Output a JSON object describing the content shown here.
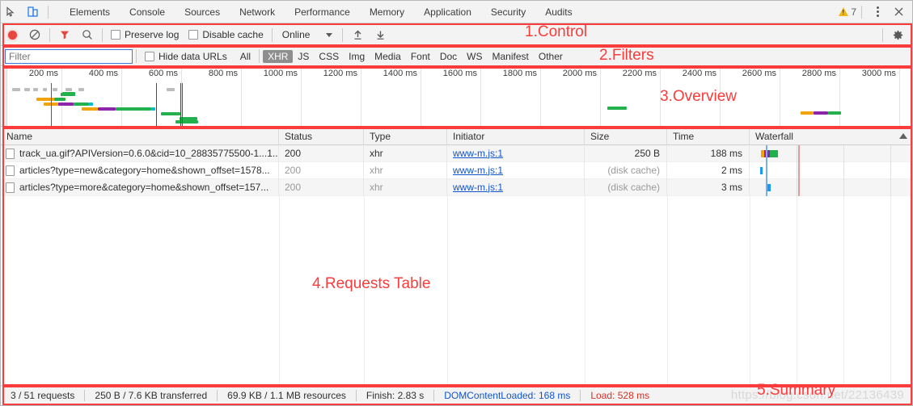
{
  "window": {
    "tabs": [
      "Elements",
      "Console",
      "Sources",
      "Network",
      "Performance",
      "Memory",
      "Application",
      "Security",
      "Audits"
    ],
    "warning_count": "7",
    "inspect_icon": "inspect-element-icon",
    "device_icon": "device-toolbar-icon",
    "more_icon": "more-options-icon",
    "close_icon": "close-icon"
  },
  "control": {
    "record_icon": "record-button",
    "clear_icon": "clear-button",
    "filter_icon": "filter-toggle-icon",
    "search_icon": "search-icon",
    "preserve_log": "Preserve log",
    "disable_cache": "Disable cache",
    "throttle_value": "Online",
    "import_icon": "import-har-icon",
    "export_icon": "export-har-icon",
    "settings_icon": "gear-icon"
  },
  "filters": {
    "placeholder": "Filter",
    "value": "",
    "hide_data_urls": "Hide data URLs",
    "types": [
      "All",
      "XHR",
      "JS",
      "CSS",
      "Img",
      "Media",
      "Font",
      "Doc",
      "WS",
      "Manifest",
      "Other"
    ],
    "active_type": "XHR"
  },
  "overview": {
    "ticks": [
      "200 ms",
      "400 ms",
      "600 ms",
      "800 ms",
      "1000 ms",
      "1200 ms",
      "1400 ms",
      "1600 ms",
      "1800 ms",
      "2000 ms",
      "2200 ms",
      "2400 ms",
      "2600 ms",
      "2800 ms",
      "3000 ms"
    ],
    "dcl_color": "#1565d8",
    "load_color": "#b02020"
  },
  "table": {
    "columns": [
      "Name",
      "Status",
      "Type",
      "Initiator",
      "Size",
      "Time",
      "Waterfall"
    ],
    "sort_column": "Waterfall",
    "rows": [
      {
        "name": "track_ua.gif?APIVersion=0.6.0&cid=10_28835775500-1...1...",
        "status": "200",
        "type": "xhr",
        "initiator": "www-m.js:1",
        "size": "250 B",
        "size_muted": false,
        "time": "188 ms"
      },
      {
        "name": "articles?type=new&category=home&shown_offset=1578...",
        "status": "200",
        "type": "xhr",
        "initiator": "www-m.js:1",
        "size": "(disk cache)",
        "size_muted": true,
        "time": "2 ms"
      },
      {
        "name": "articles?type=more&category=home&shown_offset=157...",
        "status": "200",
        "type": "xhr",
        "initiator": "www-m.js:1",
        "size": "(disk cache)",
        "size_muted": true,
        "time": "3 ms"
      }
    ]
  },
  "summary": {
    "requests": "3 / 51 requests",
    "transferred": "250 B / 7.6 KB transferred",
    "resources": "69.9 KB / 1.1 MB resources",
    "finish": "Finish: 2.83 s",
    "dom_content_loaded": "DOMContentLoaded: 168 ms",
    "load": "Load: 528 ms",
    "watermark": "https://blog.csdn.net/22136439"
  },
  "annotations": [
    {
      "label": "1.Control"
    },
    {
      "label": "2.Filters"
    },
    {
      "label": "3.Overview"
    },
    {
      "label": "4.Requests Table"
    },
    {
      "label": "5.Summary"
    }
  ]
}
